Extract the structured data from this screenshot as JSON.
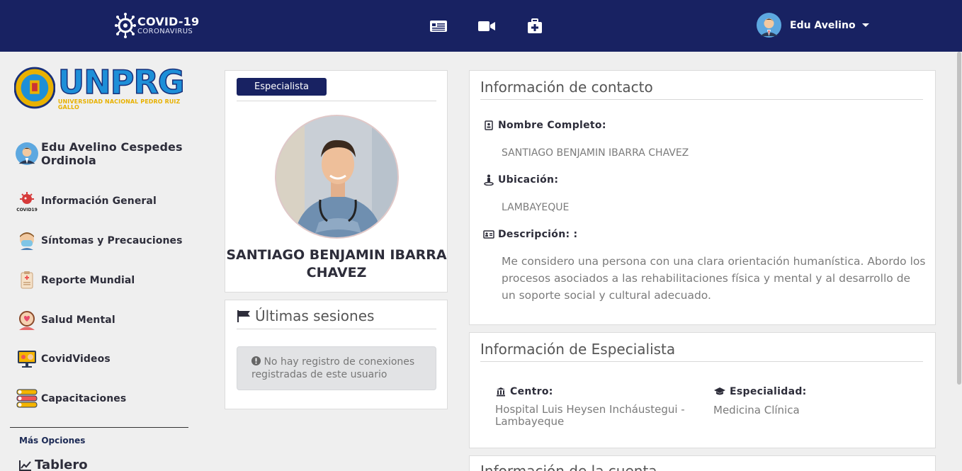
{
  "topbar": {
    "logo_line1": "COVID-19",
    "logo_line2": "CORONAVIRUS",
    "nav_icons": [
      "news-icon",
      "video-icon",
      "medical-kit-icon"
    ],
    "user_name": "Edu Avelino"
  },
  "sidebar": {
    "logo_main": "UNPRG",
    "logo_sub": "UNIVERSIDAD NACIONAL PEDRO RUIZ GALLO",
    "profile_name": "Edu Avelino Cespedes Ordinola",
    "items": [
      {
        "label": "Información General",
        "icon": "covid19-icon"
      },
      {
        "label": "Síntomas y Precauciones",
        "icon": "masked-person-icon"
      },
      {
        "label": "Reporte Mundial",
        "icon": "clipboard-report-icon"
      },
      {
        "label": "Salud Mental",
        "icon": "mental-health-icon"
      },
      {
        "label": "CovidVideos",
        "icon": "video-screen-icon"
      },
      {
        "label": "Capacitaciones",
        "icon": "training-list-icon"
      }
    ],
    "more_options": "Más Opciones",
    "tablero": "Tablero"
  },
  "profile_card": {
    "badge": "Especialista",
    "name": "SANTIAGO BENJAMIN IBARRA CHAVEZ"
  },
  "sessions_card": {
    "title": "Últimas sesiones",
    "alert": "No hay registro de conexiones registradas de este usuario"
  },
  "contact_card": {
    "title": "Información de contacto",
    "full_name_label": "Nombre Completo:",
    "full_name_value": "SANTIAGO BENJAMIN IBARRA CHAVEZ",
    "location_label": "Ubicación:",
    "location_value": "LAMBAYEQUE",
    "description_label": "Descripción: :",
    "description_value": "Me considero una persona con una clara orientación humanística. Abordo los procesos asociados a las rehabilitaciones física y mental y al desarrollo de un soporte social y cultural adecuado."
  },
  "specialist_card": {
    "title": "Información de Especialista",
    "center_label": "Centro:",
    "center_value": "Hospital Luis Heysen Incháustegui - Lambayeque",
    "specialty_label": "Especialidad:",
    "specialty_value": "Medicina Clínica"
  },
  "account_card": {
    "title": "Información de la cuenta"
  },
  "colors": {
    "navbar": "#182262",
    "badge": "#182262",
    "background": "#efefef"
  }
}
